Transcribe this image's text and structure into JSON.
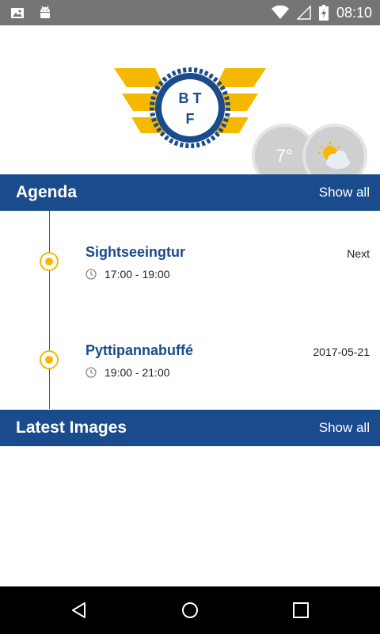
{
  "status_bar": {
    "time": "08:10"
  },
  "header": {
    "logo_text": "BTF",
    "weather": {
      "temperature": "7°",
      "icon": "partly-cloudy-icon"
    }
  },
  "agenda": {
    "title": "Agenda",
    "show_all": "Show all",
    "items": [
      {
        "title": "Sightseeingtur",
        "time": "17:00 - 19:00",
        "right_label": "Next"
      },
      {
        "title": "Pyttipannabuffé",
        "time": "19:00 - 21:00",
        "right_label": "2017-05-21"
      }
    ]
  },
  "latest_images": {
    "title": "Latest Images",
    "show_all": "Show all"
  },
  "colors": {
    "brand_blue": "#1a4b8c",
    "accent_yellow": "#f5b800",
    "status_bar": "#757575"
  }
}
